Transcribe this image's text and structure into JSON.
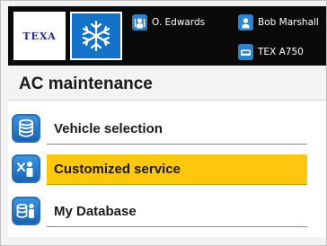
{
  "header": {
    "logo_text": "TEXA",
    "mode_icon": "snowflake-icon",
    "technician": {
      "icon": "technician-icon",
      "name": "O. Edwards"
    },
    "user": {
      "icon": "user-icon",
      "name": "Bob Marshall"
    },
    "device": {
      "icon": "device-icon",
      "name": "TEX A750"
    }
  },
  "page": {
    "title": "AC maintenance"
  },
  "menu": {
    "items": [
      {
        "label": "Vehicle selection",
        "icon": "database-icon",
        "selected": false
      },
      {
        "label": "Customized service",
        "icon": "tools-person-icon",
        "selected": true
      },
      {
        "label": "My Database",
        "icon": "person-database-icon",
        "selected": false
      }
    ]
  },
  "colors": {
    "header_bg": "#0a0a0a",
    "accent_blue": "#1473c9",
    "selected_bg": "#fdc70d"
  }
}
